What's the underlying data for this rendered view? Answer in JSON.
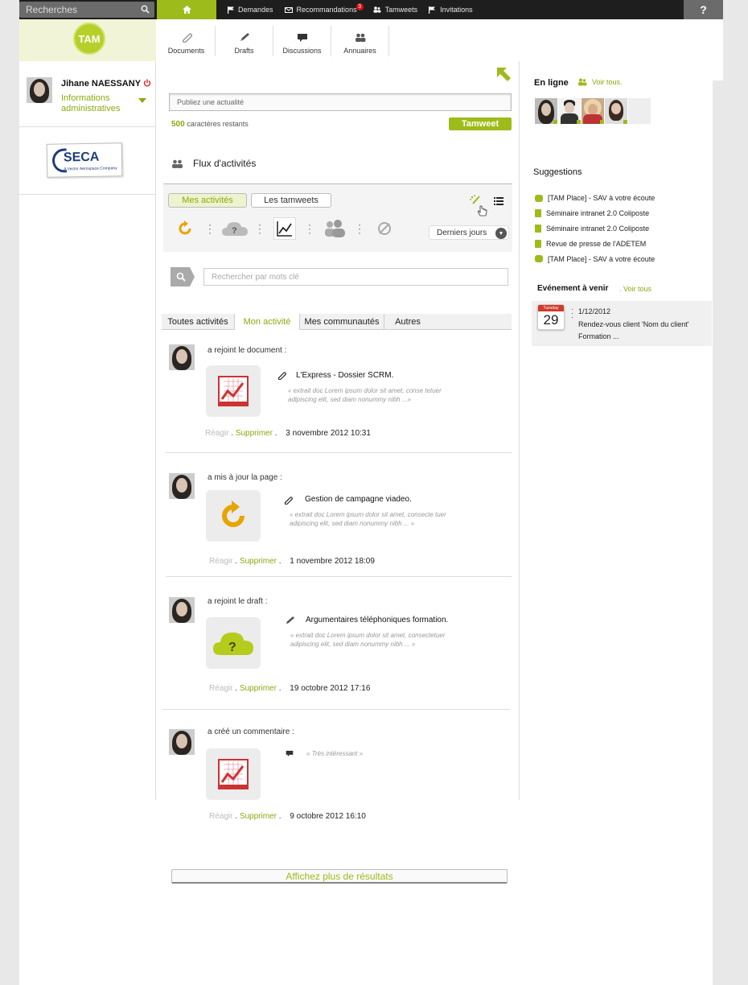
{
  "topbar": {
    "search_placeholder": "Recherches",
    "nav": [
      {
        "label": "Demandes",
        "icon": "flag-icon"
      },
      {
        "label": "Recommandations",
        "icon": "mail-icon",
        "badge": "3"
      },
      {
        "label": "Tamweets",
        "icon": "users-icon"
      },
      {
        "label": "Invitations",
        "icon": "flag-plus-icon"
      }
    ],
    "help": "?"
  },
  "toolbar": [
    {
      "label": "Documents",
      "icon": "paperclip-icon"
    },
    {
      "label": "Drafts",
      "icon": "pencil-icon"
    },
    {
      "label": "Discussions",
      "icon": "chat-icon"
    },
    {
      "label": "Annuaires",
      "icon": "people-icon"
    }
  ],
  "logo": {
    "text": "TAM"
  },
  "profile": {
    "name": "Jihane NAESSANY",
    "link": "Informations administratives"
  },
  "company": {
    "name": "SECA",
    "tagline": "A Vector Aerospace Company"
  },
  "publish": {
    "placeholder": "Publiez une actualité",
    "chars_count": "500",
    "chars_label": "caractères restants",
    "button": "Tamweet"
  },
  "flux": {
    "title": "Flux d'activités",
    "tabs": [
      "Mes activités",
      "Les tamweets"
    ],
    "period": "Derniers jours",
    "search_placeholder": "Rechercher par mots clé"
  },
  "activity_tabs": [
    "Toutes activités",
    "Mon activité",
    "Mes communautés",
    "Autres"
  ],
  "activities": [
    {
      "verb": "a rejoint le document :",
      "title": "L'Express - Dossier SCRM.",
      "excerpt": "« extrait doc Lorem ipsum dolor sit amet, conse tetuer adipiscing elit, sed diam nonummy nibh ...»",
      "react": "Réagir",
      "delete": "Supprimer",
      "date": "3 novembre 2012 10:31"
    },
    {
      "verb": "a mis à jour la page :",
      "title": "Gestion de campagne viadeo.",
      "excerpt": "« extrait doc Lorem ipsum dolor sit amet, consecte tuer adipiscing elit, sed diam nonummy nibh ... »",
      "react": "Réagir",
      "delete": "Supprimer",
      "date": "1 novembre 2012 18:09"
    },
    {
      "verb": "a rejoint le draft :",
      "title": "Argumentaires téléphoniques formation.",
      "excerpt": "« extrait doc Lorem ipsum dolor sit amet, consectetuer adipiscing elit, sed diam nonummy nibh ... »",
      "react": "Réagir",
      "delete": "Supprimer",
      "date": "19 octobre 2012 17:16"
    },
    {
      "verb": "a créé un commentaire :",
      "title": "",
      "excerpt": "« Très intéressant »",
      "react": "Réagir",
      "delete": "Supprimer",
      "date": "9 octobre 2012 16:10"
    }
  ],
  "more_results": "Affichez plus de résultats",
  "online": {
    "title": "En ligne",
    "see_all": "Voir tous."
  },
  "suggestions": {
    "title": "Suggestions",
    "items": [
      "[TAM Place] - SAV à votre écoute",
      "Séminaire intranet 2.0 Coliposte",
      "Séminaire intranet 2.0 Coliposte",
      "Revue de presse de l'ADETEM",
      "[TAM Place] - SAV à votre écoute"
    ]
  },
  "events": {
    "title": "Evénement à venir",
    "see_all": ". Voir tous",
    "calendar_day": "Tuesday",
    "calendar_num": "29",
    "date": "1/12/2012",
    "text": "Rendez-vous client 'Nom du client' Formation ..."
  },
  "colors": {
    "accent": "#9dbb1a",
    "dark": "#1e1e1e"
  }
}
